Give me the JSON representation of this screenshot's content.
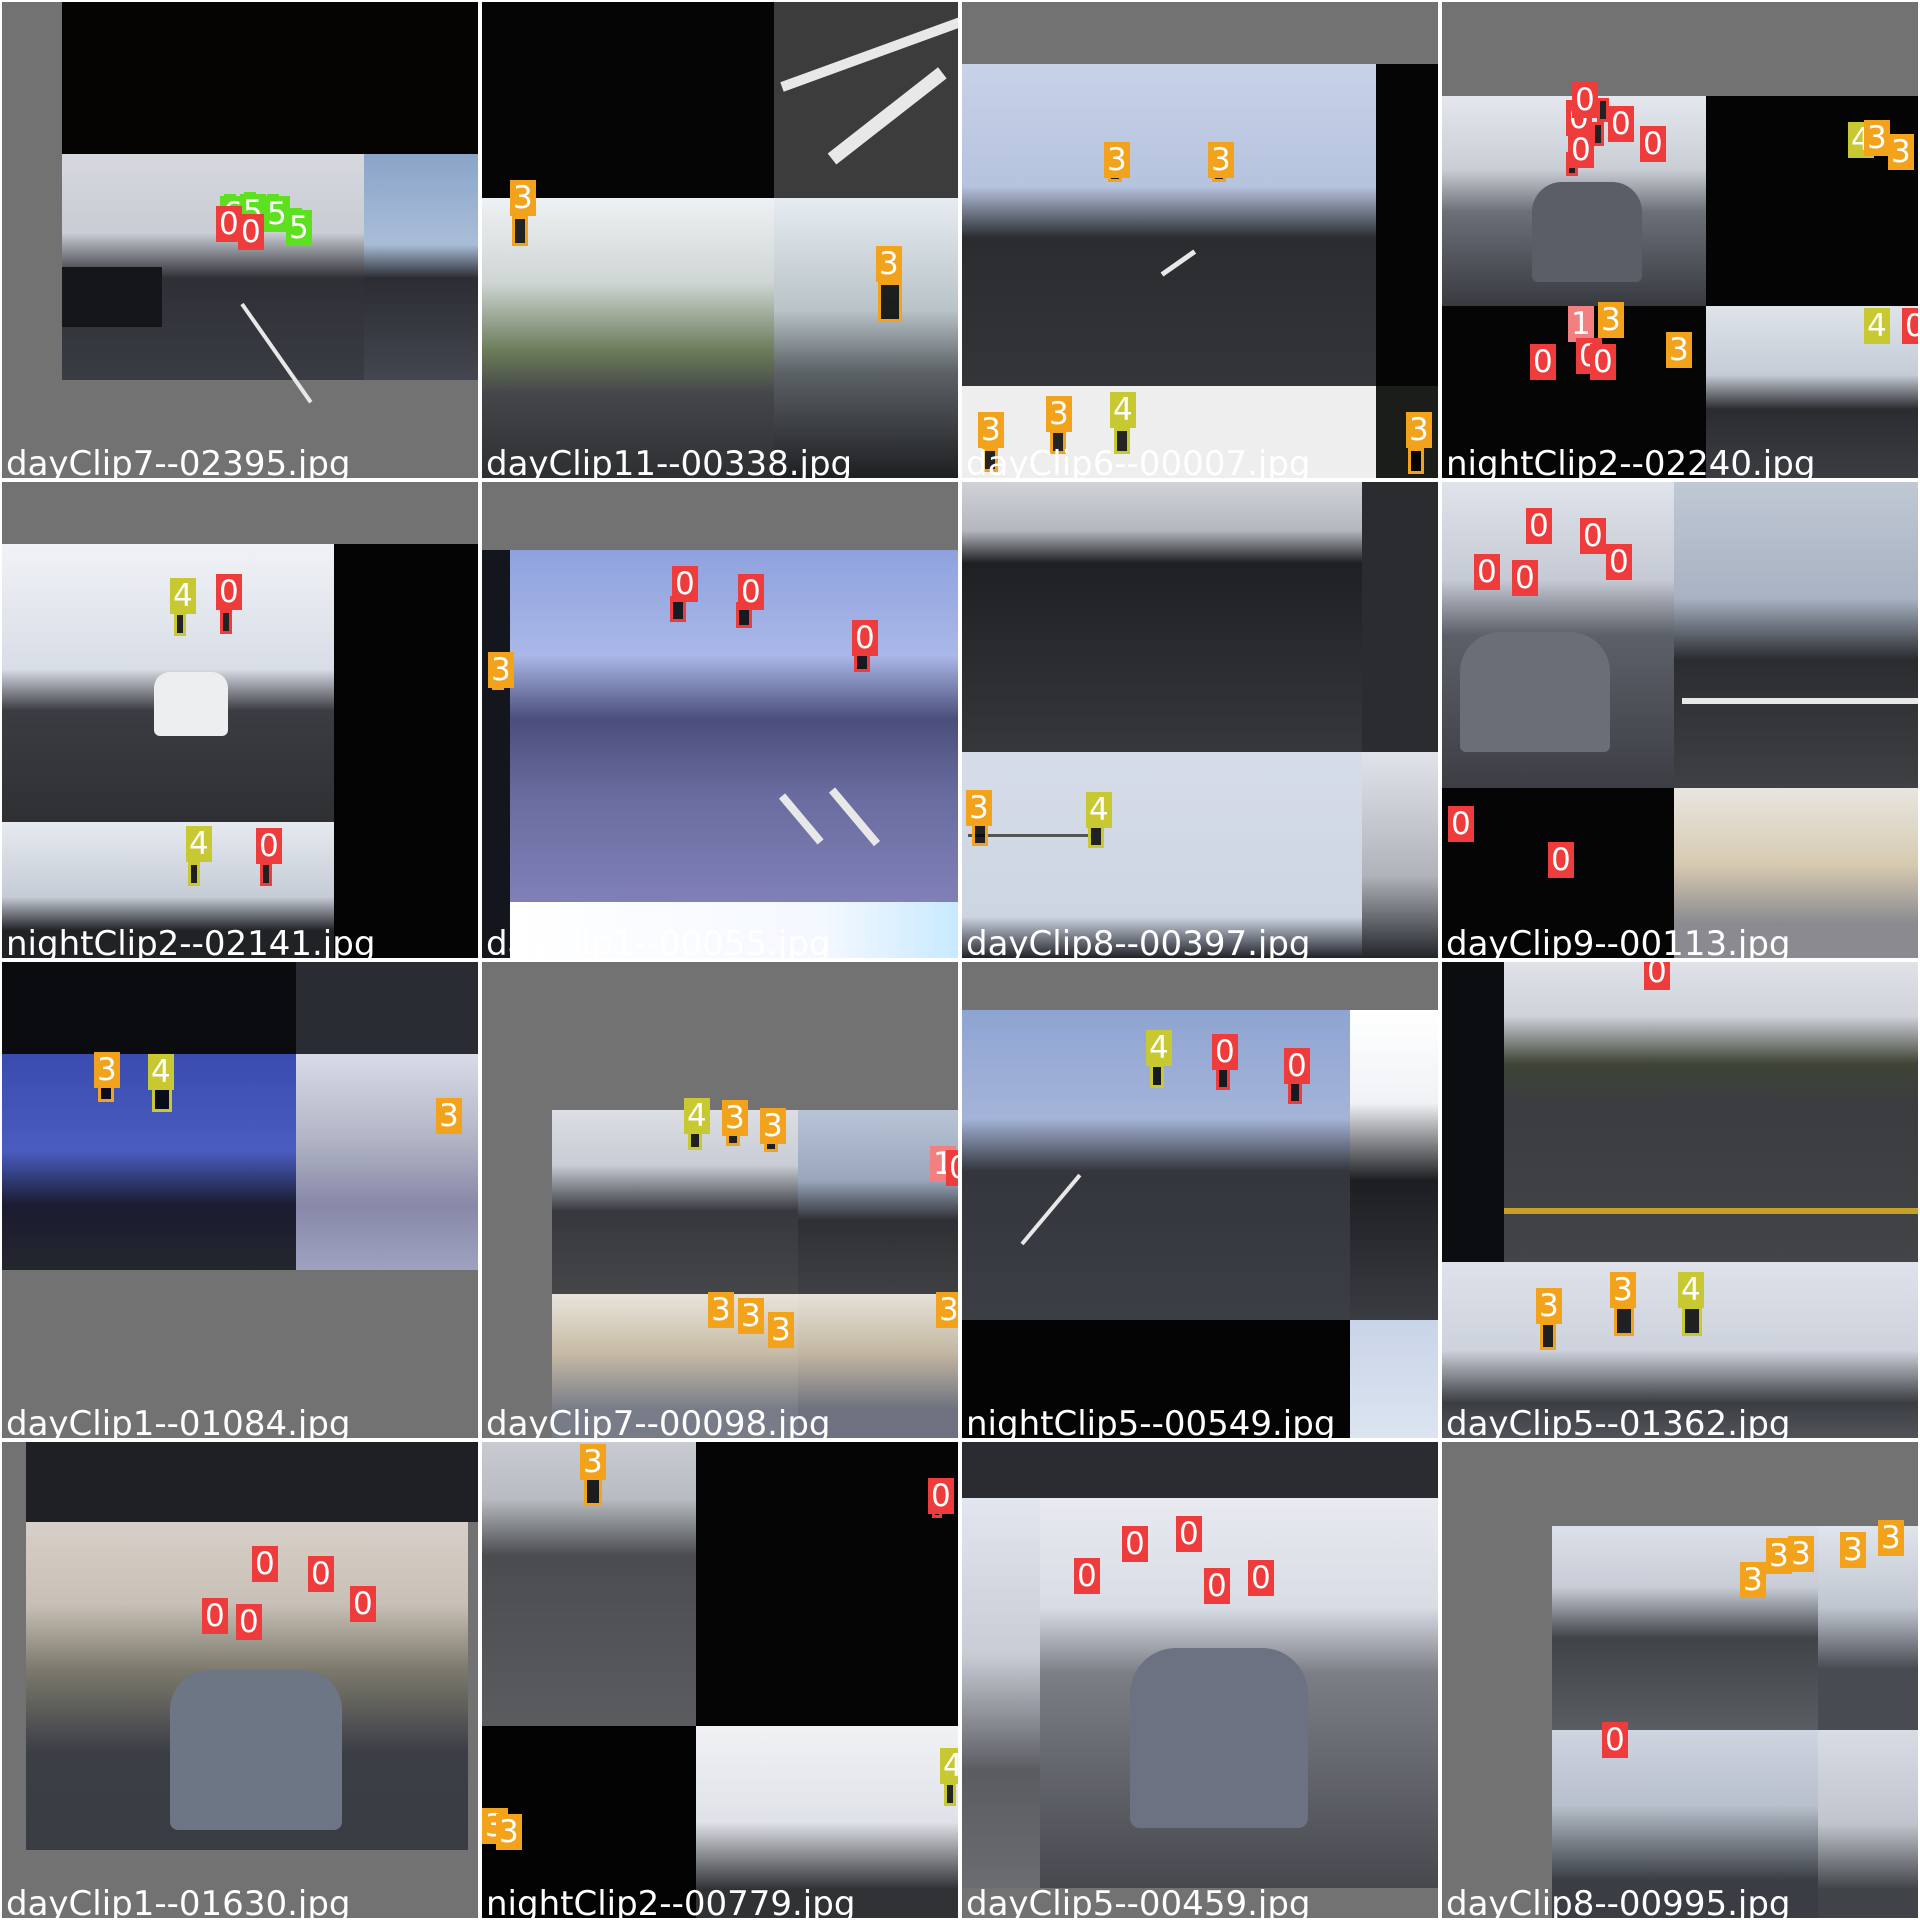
{
  "palette": {
    "class_colors": {
      "0": "#ee3b3b",
      "1": "#f28080",
      "3": "#f2a21b",
      "4": "#c8c832",
      "5": "#5de020",
      "6": "#5de020"
    },
    "filename_color": "#ffffff",
    "padding_gray": "#727272"
  },
  "tiles": [
    {
      "filename": "dayClip7--02395.jpg",
      "labels": [
        {
          "cls": "6"
        },
        {
          "cls": "5"
        },
        {
          "cls": "5"
        },
        {
          "cls": "5"
        },
        {
          "cls": "0"
        },
        {
          "cls": "0"
        }
      ]
    },
    {
      "filename": "dayClip11--00338.jpg",
      "labels": [
        {
          "cls": "3"
        },
        {
          "cls": "3"
        }
      ]
    },
    {
      "filename": "dayClip6--00007.jpg",
      "labels": [
        {
          "cls": "3"
        },
        {
          "cls": "3"
        },
        {
          "cls": "3"
        },
        {
          "cls": "3"
        },
        {
          "cls": "4"
        },
        {
          "cls": "3"
        }
      ]
    },
    {
      "filename": "nightClip2--02240.jpg",
      "labels": [
        {
          "cls": "0"
        },
        {
          "cls": "0"
        },
        {
          "cls": "0"
        },
        {
          "cls": "0"
        },
        {
          "cls": "0"
        },
        {
          "cls": "4"
        },
        {
          "cls": "3"
        },
        {
          "cls": "3"
        },
        {
          "cls": "1"
        },
        {
          "cls": "3"
        },
        {
          "cls": "0"
        },
        {
          "cls": "0"
        },
        {
          "cls": "0"
        },
        {
          "cls": "3"
        },
        {
          "cls": "4"
        },
        {
          "cls": "0"
        }
      ]
    },
    {
      "filename": "nightClip2--02141.jpg",
      "labels": [
        {
          "cls": "4"
        },
        {
          "cls": "0"
        },
        {
          "cls": "4"
        },
        {
          "cls": "0"
        }
      ]
    },
    {
      "filename": "dayClip1--00055.jpg",
      "labels": [
        {
          "cls": "0"
        },
        {
          "cls": "0"
        },
        {
          "cls": "3"
        },
        {
          "cls": "0"
        }
      ]
    },
    {
      "filename": "dayClip8--00397.jpg",
      "labels": [
        {
          "cls": "3"
        },
        {
          "cls": "4"
        }
      ]
    },
    {
      "filename": "dayClip9--00113.jpg",
      "labels": [
        {
          "cls": "0"
        },
        {
          "cls": "0"
        },
        {
          "cls": "0"
        },
        {
          "cls": "0"
        },
        {
          "cls": "0"
        },
        {
          "cls": "0"
        },
        {
          "cls": "0"
        }
      ]
    },
    {
      "filename": "dayClip1--01084.jpg",
      "labels": [
        {
          "cls": "3"
        },
        {
          "cls": "4"
        },
        {
          "cls": "3"
        }
      ]
    },
    {
      "filename": "dayClip7--00098.jpg",
      "labels": [
        {
          "cls": "4"
        },
        {
          "cls": "3"
        },
        {
          "cls": "3"
        },
        {
          "cls": "1"
        },
        {
          "cls": "0"
        },
        {
          "cls": "3"
        },
        {
          "cls": "3"
        },
        {
          "cls": "3"
        },
        {
          "cls": "3"
        }
      ]
    },
    {
      "filename": "nightClip5--00549.jpg",
      "labels": [
        {
          "cls": "4"
        },
        {
          "cls": "0"
        },
        {
          "cls": "0"
        }
      ]
    },
    {
      "filename": "dayClip5--01362.jpg",
      "labels": [
        {
          "cls": "0"
        },
        {
          "cls": "3"
        },
        {
          "cls": "3"
        },
        {
          "cls": "4"
        }
      ]
    },
    {
      "filename": "dayClip1--01630.jpg",
      "labels": [
        {
          "cls": "0"
        },
        {
          "cls": "0"
        },
        {
          "cls": "0"
        },
        {
          "cls": "0"
        },
        {
          "cls": "0"
        }
      ]
    },
    {
      "filename": "nightClip2--00779.jpg",
      "labels": [
        {
          "cls": "3"
        },
        {
          "cls": "0"
        },
        {
          "cls": "4"
        },
        {
          "cls": "3"
        },
        {
          "cls": "3"
        }
      ]
    },
    {
      "filename": "dayClip5--00459.jpg",
      "labels": [
        {
          "cls": "0"
        },
        {
          "cls": "0"
        },
        {
          "cls": "0"
        },
        {
          "cls": "0"
        },
        {
          "cls": "0"
        }
      ]
    },
    {
      "filename": "dayClip8--00995.jpg",
      "labels": [
        {
          "cls": "3"
        },
        {
          "cls": "3"
        },
        {
          "cls": "3"
        },
        {
          "cls": "3"
        },
        {
          "cls": "3"
        },
        {
          "cls": "0"
        }
      ]
    }
  ]
}
